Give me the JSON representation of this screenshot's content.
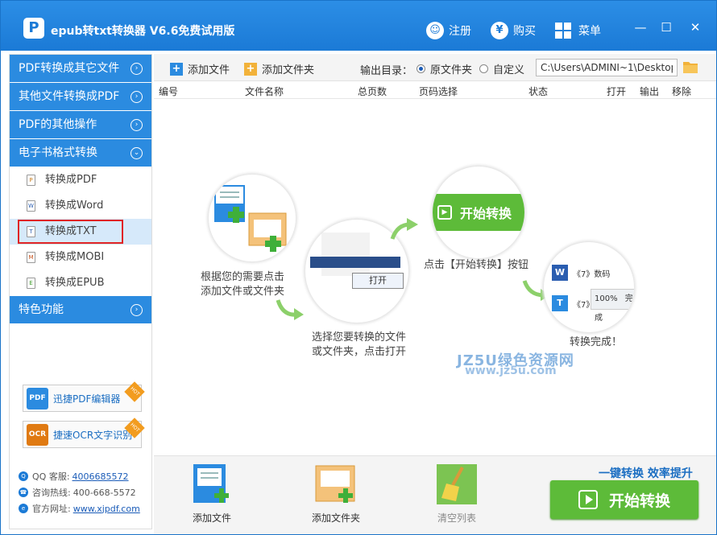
{
  "titlebar": {
    "title": "epub转txt转换器 V6.6免费试用版",
    "register_label": "注册",
    "buy_label": "购买",
    "menu_label": "菜单",
    "minimize": "—",
    "maximize": "☐",
    "close": "✕"
  },
  "sidebar": {
    "categories": [
      {
        "label": "PDF转换成其它文件"
      },
      {
        "label": "其他文件转换成PDF"
      },
      {
        "label": "PDF的其他操作"
      },
      {
        "label": "电子书格式转换"
      },
      {
        "label": "特色功能"
      }
    ],
    "items": [
      {
        "label": "转换成PDF",
        "icon": "P"
      },
      {
        "label": "转换成Word",
        "icon": "W"
      },
      {
        "label": "转换成TXT",
        "icon": "T"
      },
      {
        "label": "转换成MOBI",
        "icon": "M"
      },
      {
        "label": "转换成EPUB",
        "icon": "E"
      }
    ],
    "promos": [
      {
        "label": "迅捷PDF编辑器",
        "icon_text": "PDF",
        "hot": "HOT"
      },
      {
        "label": "捷速OCR文字识别",
        "icon_text": "OCR",
        "hot": "HOT"
      }
    ],
    "contact": {
      "qq_label": "QQ 客服:",
      "qq_value": "4006685572",
      "hotline_label": "咨询热线:",
      "hotline_value": "400-668-5572",
      "site_label": "官方网址:",
      "site_value": "www.xjpdf.com"
    }
  },
  "toolbar": {
    "add_file": "添加文件",
    "add_folder": "添加文件夹",
    "output_label": "输出目录：",
    "radio_original": "原文件夹",
    "radio_custom": "自定义",
    "path_value": "C:\\Users\\ADMINI~1\\Desktop\\"
  },
  "columns": {
    "index": "编号",
    "name": "文件名称",
    "pages": "总页数",
    "page_select": "页码选择",
    "status": "状态",
    "open": "打开",
    "output": "输出",
    "remove": "移除"
  },
  "guide": {
    "step1_line1": "根据您的需要点击",
    "step1_line2": "添加文件或文件夹",
    "step2_line1": "选择您要转换的文件",
    "step2_line2": "或文件夹，点击打开",
    "step2_open": "打开",
    "step3": "点击【开始转换】按钮",
    "step3_btn": "开始转换",
    "step4": "转换完成！",
    "step4_row1": "《7》数码",
    "step4_row2": "《7》",
    "step4_progress": "100%",
    "step4_done": "完成",
    "watermark": "JZ5U绿色资源网",
    "watermark2": "www.jz5u.com"
  },
  "bottombar": {
    "add_file": "添加文件",
    "add_folder": "添加文件夹",
    "clear_list": "清空列表",
    "slogan": "一键转换 效率提升",
    "start": "开始转换"
  },
  "colors": {
    "brand_blue": "#2b8be0",
    "start_green": "#5dbb39",
    "active_outline": "#e02424"
  }
}
